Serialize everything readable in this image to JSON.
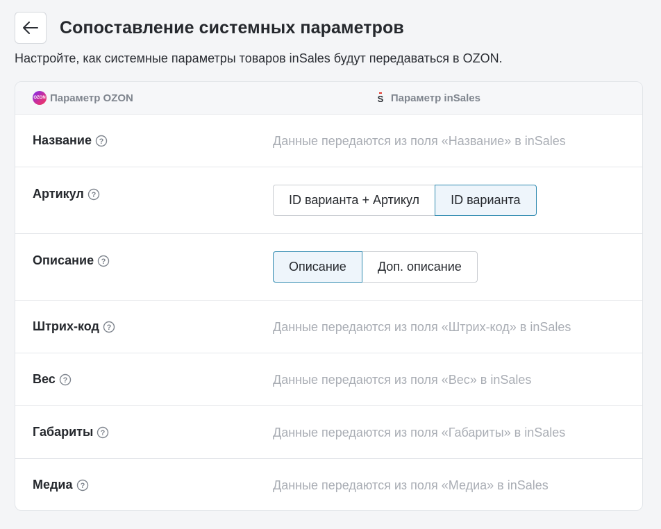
{
  "header": {
    "title": "Сопоставление системных параметров",
    "subtitle": "Настройте, как системные параметры товаров inSales будут передаваться в OZON."
  },
  "table": {
    "col_ozon": "Параметр OZON",
    "col_insales": "Параметр inSales",
    "ozon_logo_text": "OZON",
    "rows": [
      {
        "label": "Название",
        "hint": "Данные передаются из поля «Название» в inSales"
      },
      {
        "label": "Артикул",
        "options": [
          "ID варианта + Артикул",
          "ID варианта"
        ],
        "selected": 1
      },
      {
        "label": "Описание",
        "options": [
          "Описание",
          "Доп. описание"
        ],
        "selected": 0
      },
      {
        "label": "Штрих-код",
        "hint": "Данные передаются из поля «Штрих-код» в inSales"
      },
      {
        "label": "Вес",
        "hint": "Данные передаются из поля «Вес» в inSales"
      },
      {
        "label": "Габариты",
        "hint": "Данные передаются из поля «Габариты» в inSales"
      },
      {
        "label": "Медиа",
        "hint": "Данные передаются из поля «Медиа» в inSales"
      }
    ]
  },
  "colors": {
    "accent_border": "#2f8ab0",
    "accent_bg": "#eef5fb",
    "hint_text": "#a9adb4"
  },
  "icons": {
    "back": "arrow-left-icon",
    "help": "question-circle-icon"
  }
}
